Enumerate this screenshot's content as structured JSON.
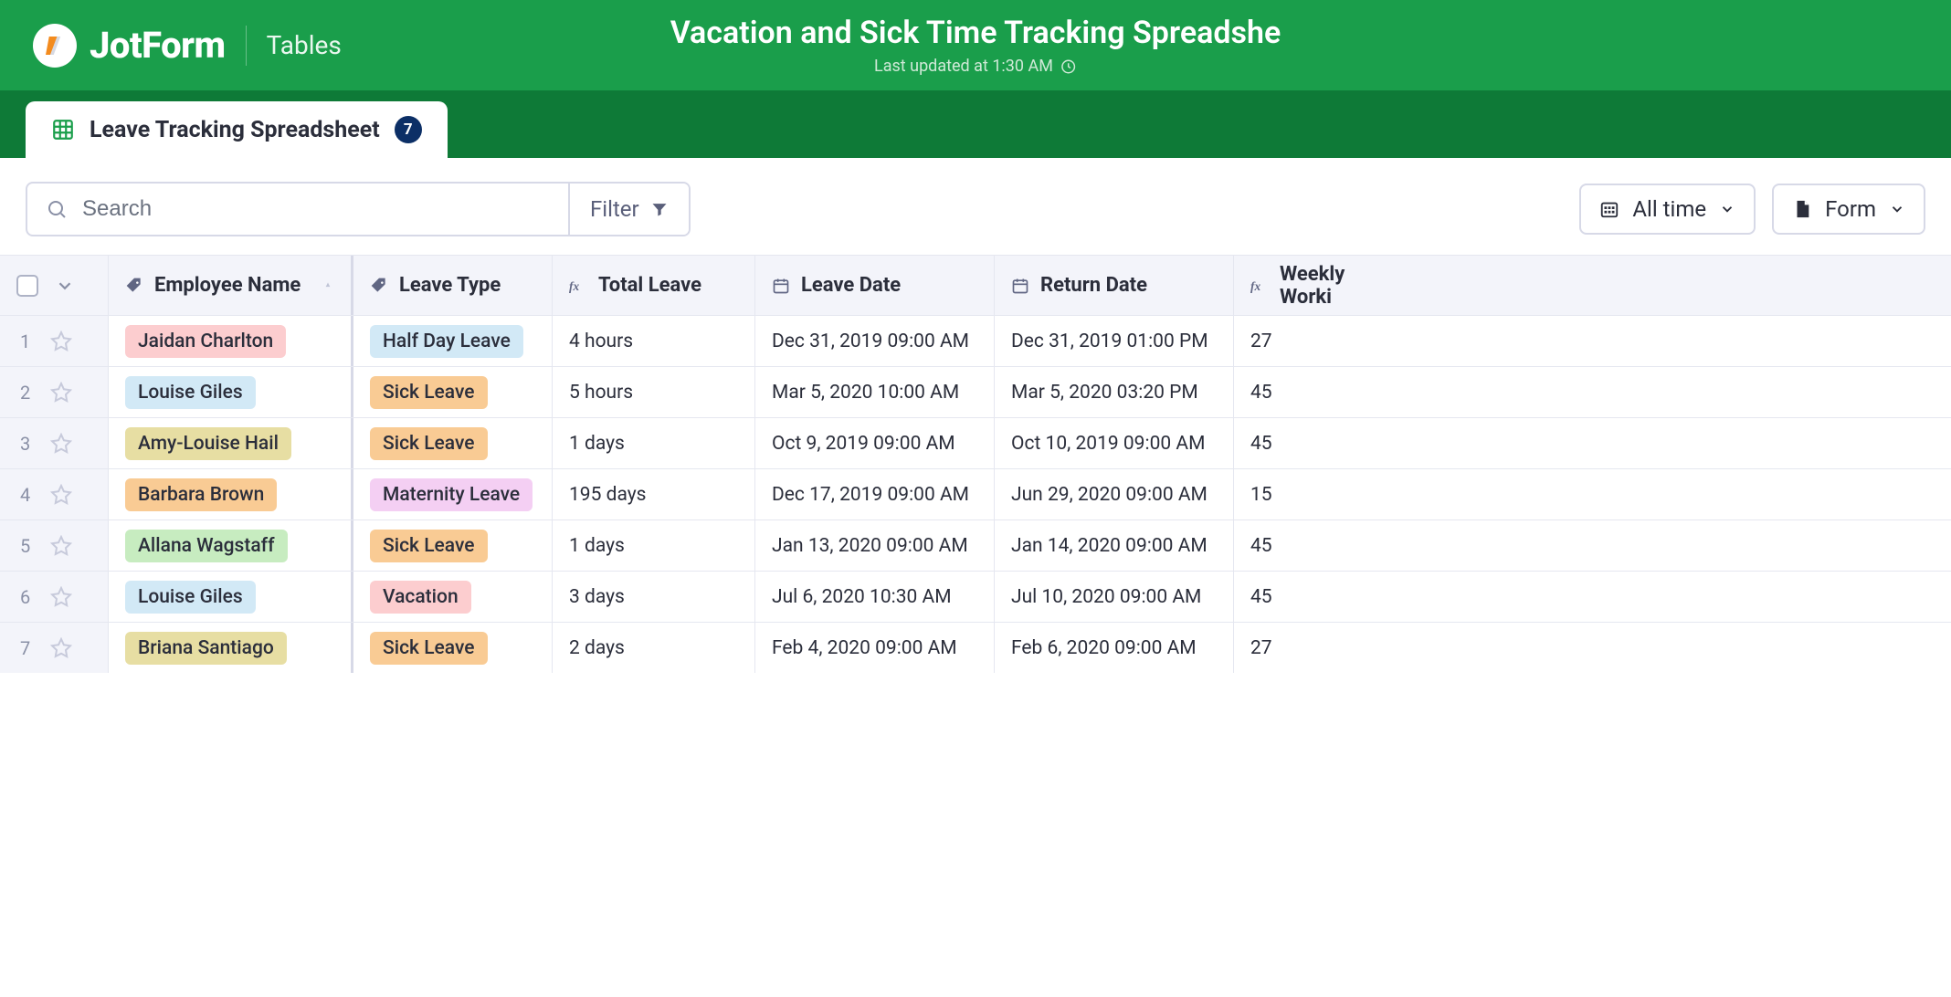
{
  "brand": {
    "name": "JotForm",
    "section": "Tables"
  },
  "header": {
    "title": "Vacation and Sick Time Tracking Spreadshe",
    "subtitle": "Last updated at 1:30 AM"
  },
  "tab": {
    "label": "Leave Tracking Spreadsheet",
    "count": "7"
  },
  "toolbar": {
    "search_placeholder": "Search",
    "filter_label": "Filter",
    "time_label": "All time",
    "form_label": "Form"
  },
  "columns": {
    "employee": "Employee Name",
    "leave_type": "Leave Type",
    "total_leave": "Total Leave",
    "leave_date": "Leave Date",
    "return_date": "Return Date",
    "weekly_working": "Weekly Worki"
  },
  "rows": [
    {
      "n": "1",
      "employee": "Jaidan Charlton",
      "emp_color": "c-pink",
      "leave_type": "Half Day Leave",
      "lt_color": "c-blue",
      "total": "4 hours",
      "leave_date": "Dec 31, 2019 09:00 AM",
      "return_date": "Dec 31, 2019 01:00 PM",
      "weekly": "27"
    },
    {
      "n": "2",
      "employee": "Louise Giles",
      "emp_color": "c-blue",
      "leave_type": "Sick Leave",
      "lt_color": "c-orange",
      "total": "5 hours",
      "leave_date": "Mar 5, 2020 10:00 AM",
      "return_date": "Mar 5, 2020 03:20 PM",
      "weekly": "45"
    },
    {
      "n": "3",
      "employee": "Amy-Louise Hail",
      "emp_color": "c-cream",
      "leave_type": "Sick Leave",
      "lt_color": "c-orange",
      "total": "1 days",
      "leave_date": "Oct 9, 2019 09:00 AM",
      "return_date": "Oct 10, 2019 09:00 AM",
      "weekly": "45"
    },
    {
      "n": "4",
      "employee": "Barbara Brown",
      "emp_color": "c-orange",
      "leave_type": "Maternity Leave",
      "lt_color": "c-violet",
      "total": "195 days",
      "leave_date": "Dec 17, 2019 09:00 AM",
      "return_date": "Jun 29, 2020 09:00 AM",
      "weekly": "15"
    },
    {
      "n": "5",
      "employee": "Allana Wagstaff",
      "emp_color": "c-lgreen",
      "leave_type": "Sick Leave",
      "lt_color": "c-orange",
      "total": "1 days",
      "leave_date": "Jan 13, 2020 09:00 AM",
      "return_date": "Jan 14, 2020 09:00 AM",
      "weekly": "45"
    },
    {
      "n": "6",
      "employee": "Louise Giles",
      "emp_color": "c-blue",
      "leave_type": "Vacation",
      "lt_color": "c-pink",
      "total": "3 days",
      "leave_date": "Jul 6, 2020 10:30 AM",
      "return_date": "Jul 10, 2020 09:00 AM",
      "weekly": "45"
    },
    {
      "n": "7",
      "employee": "Briana Santiago",
      "emp_color": "c-cream",
      "leave_type": "Sick Leave",
      "lt_color": "c-orange",
      "total": "2 days",
      "leave_date": "Feb 4, 2020 09:00 AM",
      "return_date": "Feb 6, 2020 09:00 AM",
      "weekly": "27"
    }
  ]
}
